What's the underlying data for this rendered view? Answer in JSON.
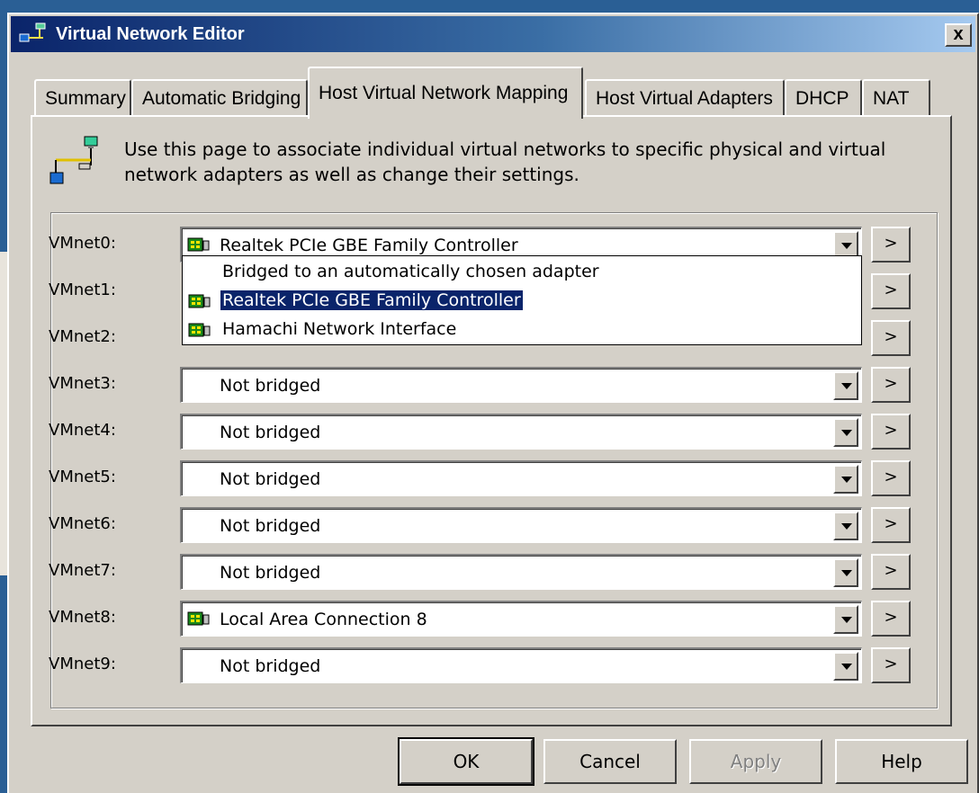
{
  "window": {
    "title": "Virtual Network Editor",
    "close_label": "x"
  },
  "tabs": [
    {
      "label": "Summary",
      "active": false
    },
    {
      "label": "Automatic Bridging",
      "active": false
    },
    {
      "label": "Host Virtual Network Mapping",
      "active": true
    },
    {
      "label": "Host Virtual Adapters",
      "active": false
    },
    {
      "label": "DHCP",
      "active": false
    },
    {
      "label": "NAT",
      "active": false
    }
  ],
  "info": {
    "icon": "network-mapping-icon",
    "text": "Use this page to associate individual virtual networks to specific physical and virtual network adapters as well as change their settings."
  },
  "vmnets": [
    {
      "label": "VMnet0:",
      "value": "Realtek PCIe GBE Family Controller",
      "icon": "network-card-icon",
      "button": ">"
    },
    {
      "label": "VMnet1:",
      "value": "",
      "icon": "",
      "button": ">"
    },
    {
      "label": "VMnet2:",
      "value": "",
      "icon": "",
      "button": ">"
    },
    {
      "label": "VMnet3:",
      "value": "Not bridged",
      "icon": "",
      "button": ">"
    },
    {
      "label": "VMnet4:",
      "value": "Not bridged",
      "icon": "",
      "button": ">"
    },
    {
      "label": "VMnet5:",
      "value": "Not bridged",
      "icon": "",
      "button": ">"
    },
    {
      "label": "VMnet6:",
      "value": "Not bridged",
      "icon": "",
      "button": ">"
    },
    {
      "label": "VMnet7:",
      "value": "Not bridged",
      "icon": "",
      "button": ">"
    },
    {
      "label": "VMnet8:",
      "value": "Local Area Connection 8",
      "icon": "network-card-icon",
      "button": ">"
    },
    {
      "label": "VMnet9:",
      "value": "Not bridged",
      "icon": "",
      "button": ">"
    }
  ],
  "dropdown": {
    "options": [
      {
        "label": "Bridged to an automatically chosen adapter",
        "icon": "",
        "selected": false
      },
      {
        "label": "Realtek PCIe GBE Family Controller",
        "icon": "network-card-icon",
        "selected": true
      },
      {
        "label": "Hamachi Network Interface",
        "icon": "network-card-icon",
        "selected": false
      }
    ]
  },
  "buttons": {
    "ok": "OK",
    "cancel": "Cancel",
    "apply": "Apply",
    "help": "Help"
  },
  "colors": {
    "selection": "#0a246a",
    "titlebar_start": "#0a246a",
    "titlebar_end": "#a6caf0",
    "face": "#d4d0c8"
  }
}
